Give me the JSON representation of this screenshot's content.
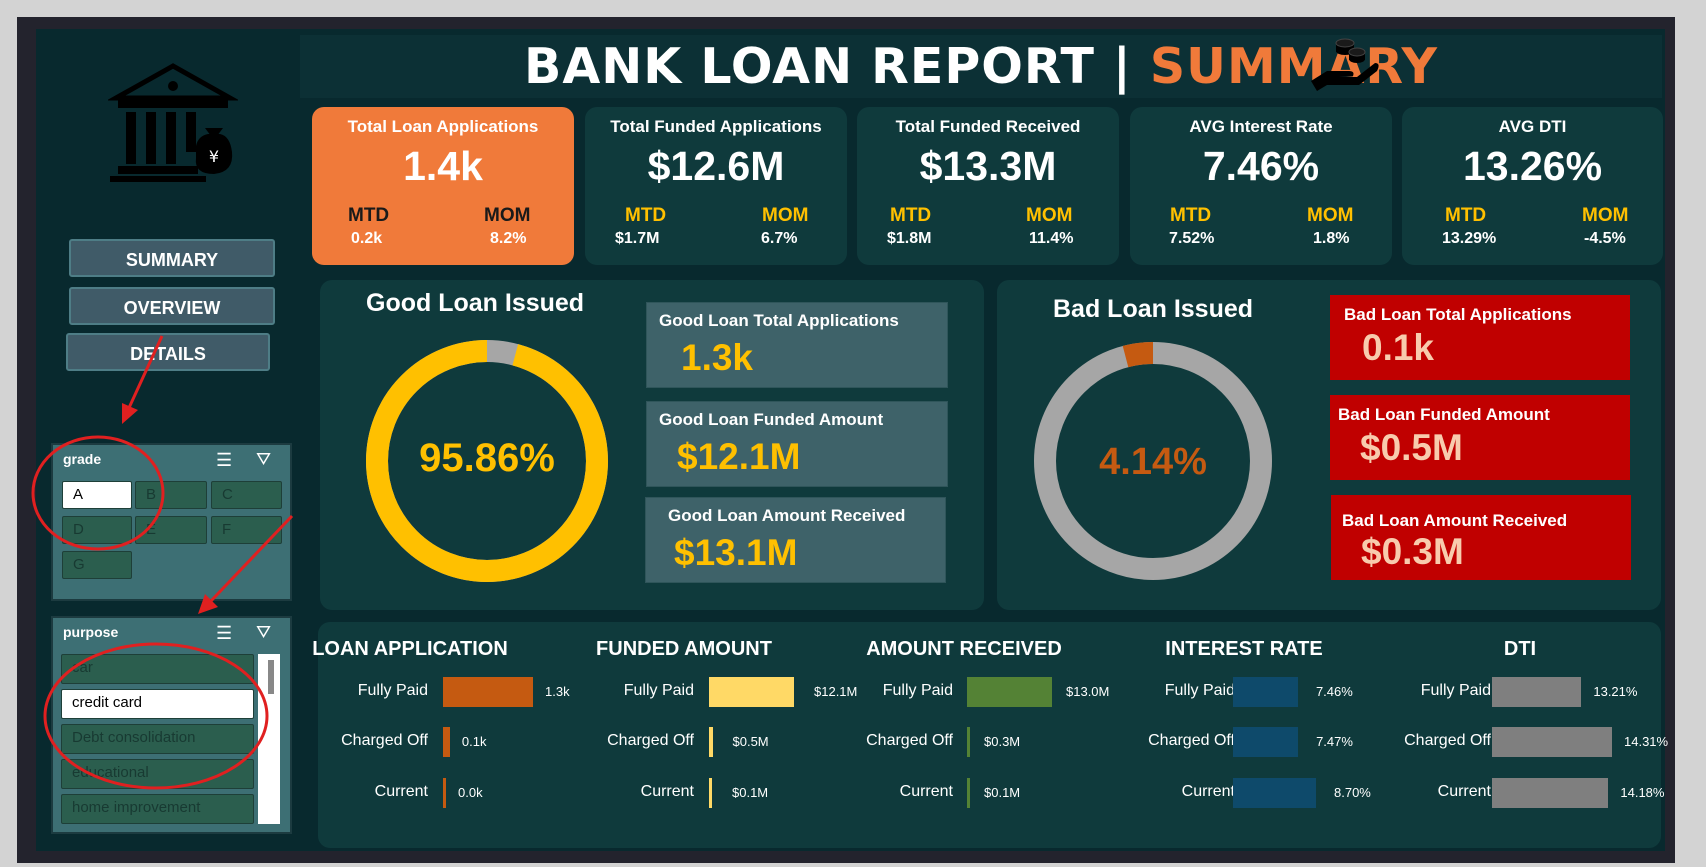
{
  "header": {
    "title_main": "BANK LOAN REPORT | ",
    "title_accent": "SUMMARY"
  },
  "nav": [
    {
      "label": "SUMMARY"
    },
    {
      "label": "OVERVIEW"
    },
    {
      "label": "DETAILS"
    }
  ],
  "slicers": {
    "grade": {
      "title": "grade",
      "items": [
        "A",
        "B",
        "C",
        "D",
        "E",
        "F",
        "G"
      ],
      "selected": "A"
    },
    "purpose": {
      "title": "purpose",
      "items": [
        "car",
        "credit card",
        "Debt consolidation",
        "educational",
        "home improvement"
      ],
      "selected": "credit card"
    }
  },
  "kpis": [
    {
      "title": "Total Loan Applications",
      "value": "1.4k",
      "mtd_label": "MTD",
      "mtd": "0.2k",
      "mom_label": "MOM",
      "mom": "8.2%"
    },
    {
      "title": "Total Funded Applications",
      "value": "$12.6M",
      "mtd_label": "MTD",
      "mtd": "$1.7M",
      "mom_label": "MOM",
      "mom": "6.7%"
    },
    {
      "title": "Total Funded Received",
      "value": "$13.3M",
      "mtd_label": "MTD",
      "mtd": "$1.8M",
      "mom_label": "MOM",
      "mom": "11.4%"
    },
    {
      "title": "AVG Interest Rate",
      "value": "7.46%",
      "mtd_label": "MTD",
      "mtd": "7.52%",
      "mom_label": "MOM",
      "mom": "1.8%"
    },
    {
      "title": "AVG DTI",
      "value": "13.26%",
      "mtd_label": "MTD",
      "mtd": "13.29%",
      "mom_label": "MOM",
      "mom": "-4.5%"
    }
  ],
  "good_loan": {
    "title": "Good Loan Issued",
    "percent_label": "95.86%",
    "boxes": [
      {
        "title": "Good Loan Total Applications",
        "value": "1.3k"
      },
      {
        "title": "Good Loan Funded Amount",
        "value": "$12.1M"
      },
      {
        "title": "Good Loan Amount Received",
        "value": "$13.1M"
      }
    ]
  },
  "bad_loan": {
    "title": "Bad Loan Issued",
    "percent_label": "4.14%",
    "boxes": [
      {
        "title": "Bad Loan Total Applications",
        "value": "0.1k"
      },
      {
        "title": "Bad Loan Funded Amount",
        "value": "$0.5M"
      },
      {
        "title": "Bad Loan Amount Received",
        "value": "$0.3M"
      }
    ]
  },
  "colors": {
    "orange": "#f07a3a",
    "gold": "#ffc000",
    "red": "#c00000",
    "grey": "#a6a6a6",
    "bad_slice": "#c55a11"
  },
  "chart_data": [
    {
      "type": "pie",
      "title": "Good Loan Issued",
      "categories": [
        "Good Loan",
        "Bad Loan"
      ],
      "values": [
        95.86,
        4.14
      ]
    },
    {
      "type": "pie",
      "title": "Bad Loan Issued",
      "categories": [
        "Bad Loan",
        "Good Loan"
      ],
      "values": [
        4.14,
        95.86
      ]
    },
    {
      "type": "bar",
      "title": "LOAN APPLICATION",
      "categories": [
        "Fully Paid",
        "Charged Off",
        "Current"
      ],
      "values": [
        1.3,
        0.1,
        0.0
      ],
      "labels": [
        "1.3k",
        "0.1k",
        "0.0k"
      ],
      "color": "#c55a11"
    },
    {
      "type": "bar",
      "title": "FUNDED AMOUNT",
      "categories": [
        "Fully Paid",
        "Charged Off",
        "Current"
      ],
      "values": [
        12.1,
        0.5,
        0.1
      ],
      "labels": [
        "$12.1M",
        "$0.5M",
        "$0.1M"
      ],
      "color": "#ffd966"
    },
    {
      "type": "bar",
      "title": "AMOUNT RECEIVED",
      "categories": [
        "Fully Paid",
        "Charged Off",
        "Current"
      ],
      "values": [
        13.0,
        0.3,
        0.1
      ],
      "labels": [
        "$13.0M",
        "$0.3M",
        "$0.1M"
      ],
      "color": "#548235"
    },
    {
      "type": "bar",
      "title": "INTEREST RATE",
      "categories": [
        "Fully Paid",
        "Charged Off",
        "Current"
      ],
      "values": [
        7.46,
        7.47,
        8.7
      ],
      "labels": [
        "7.46%",
        "7.47%",
        "8.70%"
      ],
      "color": "#0e4a6b"
    },
    {
      "type": "bar",
      "title": "DTI",
      "categories": [
        "Fully Paid",
        "Charged Off",
        "Current"
      ],
      "values": [
        13.21,
        14.31,
        14.18
      ],
      "labels": [
        "13.21%",
        "14.31%",
        "14.18%"
      ],
      "color": "#7f7f7f"
    }
  ]
}
